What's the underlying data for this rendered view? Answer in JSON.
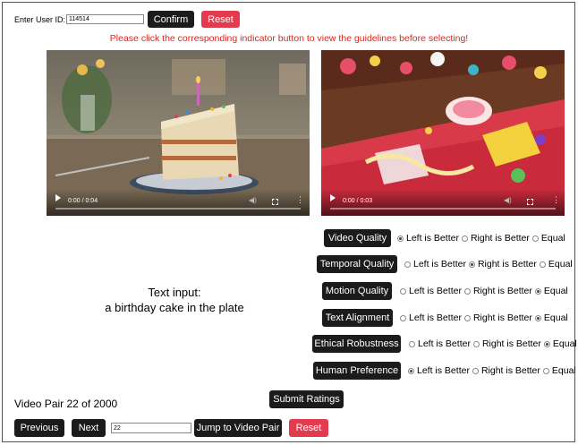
{
  "header": {
    "user_id_label": "Enter User ID:",
    "user_id_value": "114514",
    "confirm_label": "Confirm",
    "reset_label": "Reset"
  },
  "notice": "Please click the corresponding indicator button to view the guidelines before selecting!",
  "videos": [
    {
      "time": "0:00 / 0:04",
      "description": "slice of birthday cake with candle on plate"
    },
    {
      "time": "0:00 / 0:03",
      "description": "close-up of colorful decorated cake"
    }
  ],
  "prompt": {
    "line1": "Text input:",
    "line2": "a birthday cake in the plate"
  },
  "options": {
    "left": "Left is Better",
    "right": "Right is Better",
    "equal": "Equal"
  },
  "ratings": [
    {
      "label": "Video Quality",
      "selected": "left"
    },
    {
      "label": "Temporal Quality",
      "selected": "right"
    },
    {
      "label": "Motion Quality",
      "selected": "equal"
    },
    {
      "label": "Text Alignment",
      "selected": "equal"
    },
    {
      "label": "Ethical Robustness",
      "selected": "equal"
    },
    {
      "label": "Human Preference",
      "selected": "left"
    }
  ],
  "submit_label": "Submit Ratings",
  "pair_status": "Video Pair 22 of 2000",
  "footer": {
    "previous_label": "Previous",
    "next_label": "Next",
    "jump_value": "22",
    "jump_label": "Jump to Video Pair",
    "reset_label": "Reset"
  },
  "colors": {
    "accent_red": "#e23b4e",
    "notice_red": "#e0241c",
    "button_dark": "#1b1b1b"
  }
}
